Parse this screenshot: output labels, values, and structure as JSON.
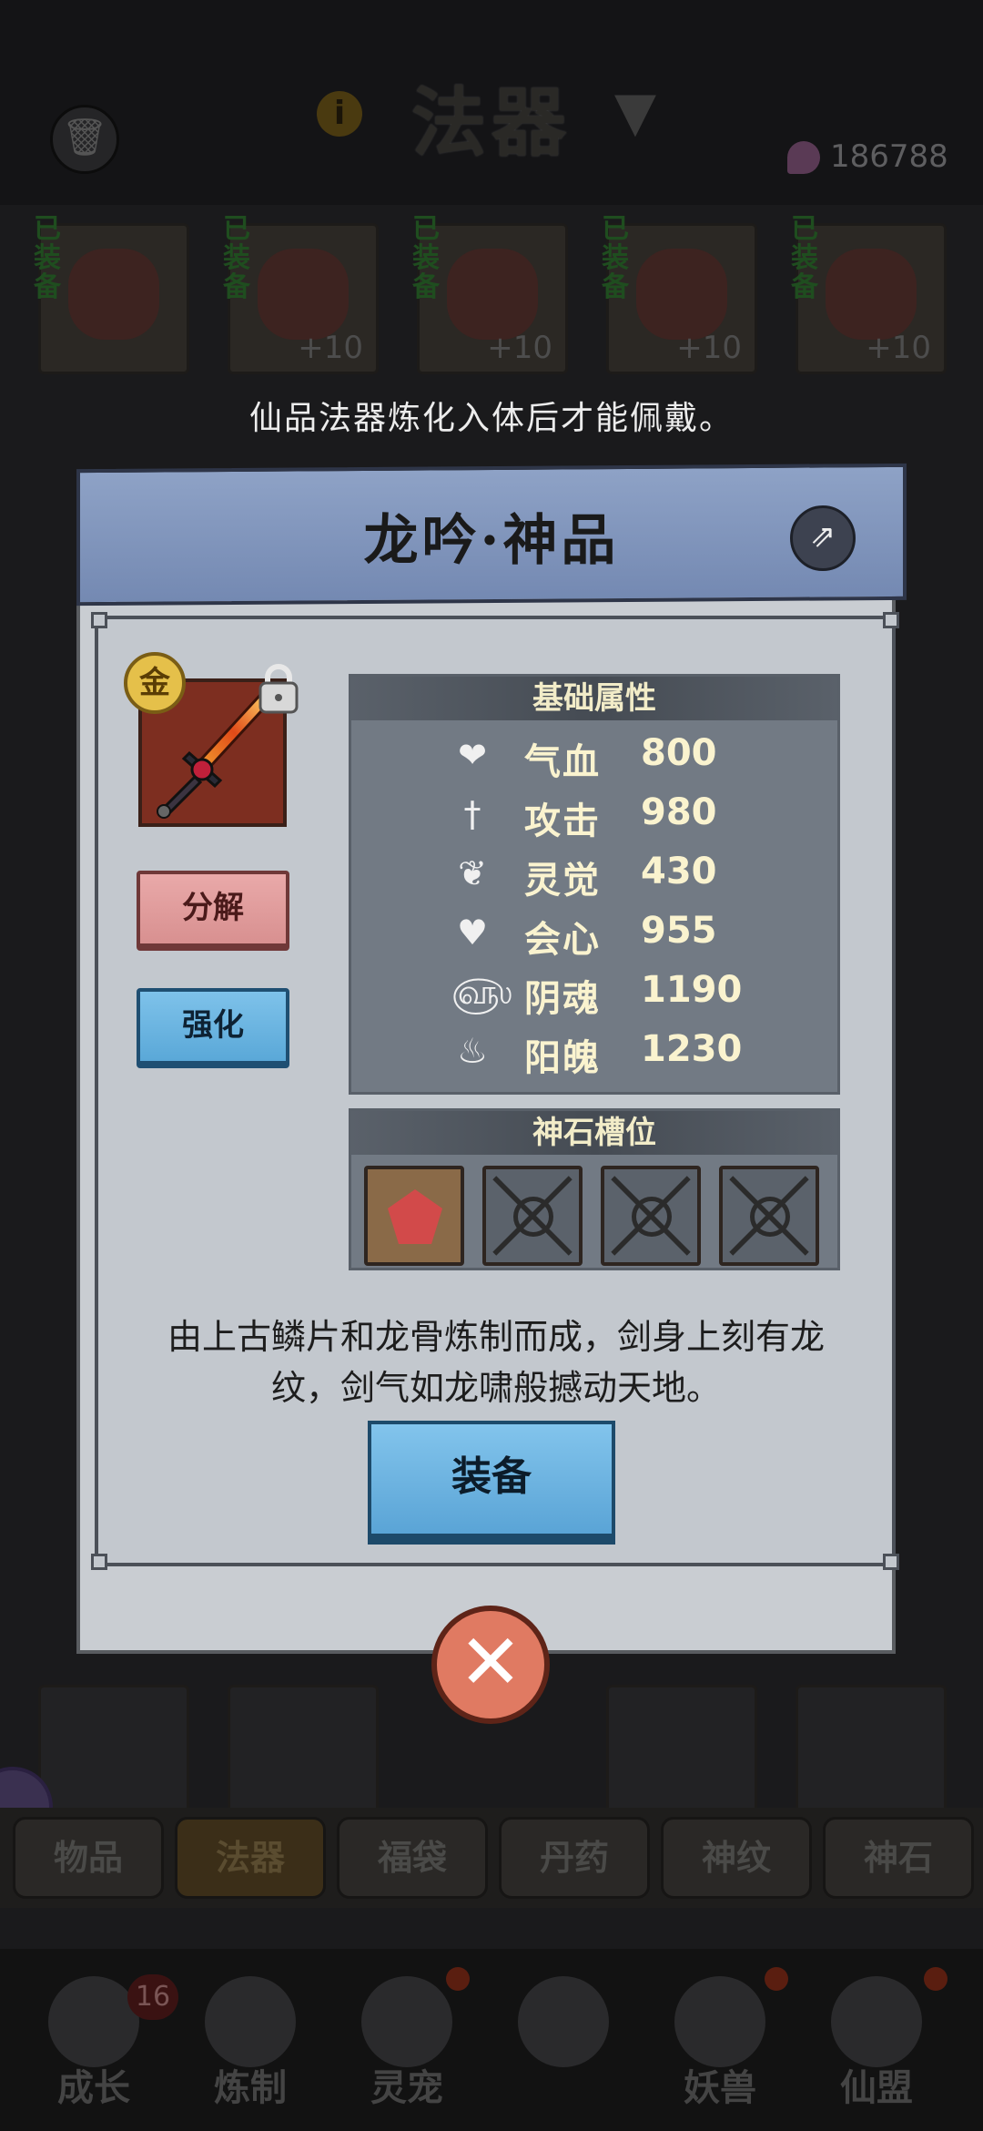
{
  "header": {
    "title": "法器",
    "currency_value": "186788",
    "icons": [
      "trash-icon",
      "info-icon",
      "filter-icon",
      "gem-icon"
    ]
  },
  "inventory": {
    "equipped_tag": "已装备",
    "items": [
      {
        "plus": "",
        "equipped": true
      },
      {
        "plus": "+10",
        "equipped": true
      },
      {
        "plus": "+10",
        "equipped": true
      },
      {
        "plus": "+10",
        "equipped": true
      },
      {
        "plus": "+10",
        "equipped": true
      }
    ]
  },
  "notice": "仙品法器炼化入体后才能佩戴。",
  "modal": {
    "title": "龙吟·神品",
    "grade_badge": "金",
    "buttons": {
      "decompose": "分解",
      "enhance": "强化",
      "equip": "装备"
    },
    "stats_header": "基础属性",
    "stats": [
      {
        "icon": "heart-icon",
        "name": "气血",
        "value": "800"
      },
      {
        "icon": "sword-icon",
        "name": "攻击",
        "value": "980"
      },
      {
        "icon": "lotus-icon",
        "name": "灵觉",
        "value": "430"
      },
      {
        "icon": "crit-heart-icon",
        "name": "会心",
        "value": "955"
      },
      {
        "icon": "yin-swirl-icon",
        "name": "阴魂",
        "value": "1190"
      },
      {
        "icon": "yang-flame-icon",
        "name": "阳魄",
        "value": "1230"
      }
    ],
    "sockets_header": "神石槽位",
    "sockets": [
      {
        "state": "filled"
      },
      {
        "state": "locked"
      },
      {
        "state": "locked"
      },
      {
        "state": "locked"
      }
    ],
    "description": "由上古鳞片和龙骨炼制而成，剑身上刻有龙纹，剑气如龙啸般撼动天地。"
  },
  "bottom_tabs": [
    {
      "label": "物品",
      "active": false
    },
    {
      "label": "法器",
      "active": true
    },
    {
      "label": "福袋",
      "active": false
    },
    {
      "label": "丹药",
      "active": false
    },
    {
      "label": "神纹",
      "active": false
    },
    {
      "label": "神石",
      "active": false
    }
  ],
  "nav": [
    {
      "label": "成长",
      "badge": "16"
    },
    {
      "label": "炼制",
      "badge": ""
    },
    {
      "label": "灵宠",
      "badge": ""
    },
    {
      "label": "",
      "badge": ""
    },
    {
      "label": "妖兽",
      "badge": ""
    },
    {
      "label": "仙盟",
      "badge": ""
    }
  ],
  "colors": {
    "modal_header": "#7f95bd",
    "stat_text": "#faf3cf",
    "enhance_blue": "#6cb6e2",
    "decompose_pink": "#e19c9c",
    "close_red": "#e07a62"
  }
}
